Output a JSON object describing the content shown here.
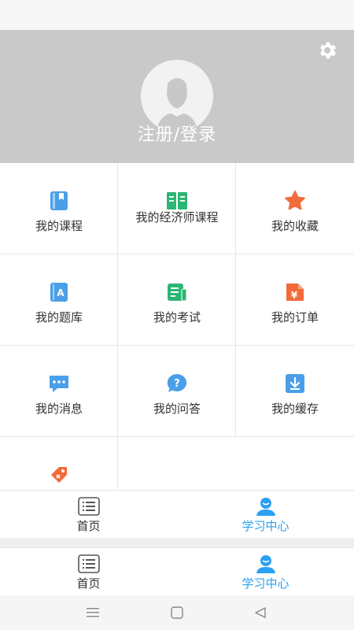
{
  "header": {
    "login_label": "注册/登录",
    "bg_color": "#c9c9c9",
    "icons": {
      "settings": "gear-icon",
      "avatar": "user-avatar-icon"
    }
  },
  "menu": {
    "items": [
      {
        "label": "我的课程",
        "icon": "course-book-icon",
        "color": "#4a9fe8"
      },
      {
        "label": "我的经济师课程",
        "icon": "open-book-icon",
        "color": "#2bb673"
      },
      {
        "label": "我的收藏",
        "icon": "star-icon",
        "color": "#f26b3a"
      },
      {
        "label": "我的题库",
        "icon": "question-bank-icon",
        "color": "#4a9fe8"
      },
      {
        "label": "我的考试",
        "icon": "exam-icon",
        "color": "#2bb673"
      },
      {
        "label": "我的订单",
        "icon": "order-icon",
        "color": "#f26b3a"
      },
      {
        "label": "我的消息",
        "icon": "message-icon",
        "color": "#4a9fe8"
      },
      {
        "label": "我的问答",
        "icon": "qa-icon",
        "color": "#4a9fe8"
      },
      {
        "label": "我的缓存",
        "icon": "download-icon",
        "color": "#4a9fe8"
      },
      {
        "label": "",
        "icon": "coupon-icon",
        "color": "#f26b3a"
      }
    ]
  },
  "tabbar": {
    "home_label": "首页",
    "study_label": "学习中心",
    "active_color": "#2aa0f2"
  },
  "tabbar2": {
    "home_label": "首页",
    "study_label": "学习中心"
  }
}
